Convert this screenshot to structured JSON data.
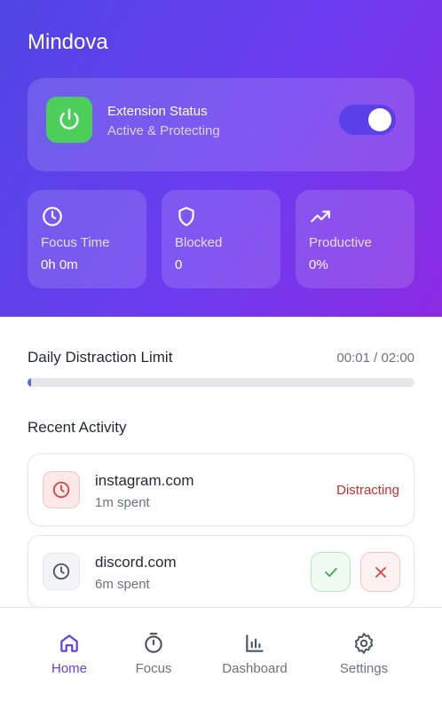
{
  "app": {
    "title": "Mindova"
  },
  "status": {
    "title": "Extension Status",
    "subtitle": "Active & Protecting",
    "enabled": true,
    "icon": "power-icon"
  },
  "stats": [
    {
      "icon": "clock-icon",
      "label": "Focus Time",
      "value": "0h 0m"
    },
    {
      "icon": "shield-icon",
      "label": "Blocked",
      "value": "0"
    },
    {
      "icon": "trending-up-icon",
      "label": "Productive",
      "value": "0%"
    }
  ],
  "limit": {
    "title": "Daily Distraction Limit",
    "time": "00:01 / 02:00",
    "progress_fraction": 0.008
  },
  "activity": {
    "title": "Recent Activity",
    "items": [
      {
        "site": "instagram.com",
        "time": "1m spent",
        "badge": "Distracting",
        "icon": "clock-icon"
      },
      {
        "site": "discord.com",
        "time": "6m spent",
        "icon": "clock-icon"
      }
    ]
  },
  "nav": [
    {
      "label": "Home",
      "icon": "home-icon",
      "active": true
    },
    {
      "label": "Focus",
      "icon": "timer-icon",
      "active": false
    },
    {
      "label": "Dashboard",
      "icon": "bar-chart-icon",
      "active": false
    },
    {
      "label": "Settings",
      "icon": "gear-icon",
      "active": false
    }
  ],
  "colors": {
    "gradient_start": "#4f46e5",
    "gradient_end": "#8b2be2",
    "power_green": "#4ccf5a",
    "accent": "#5b3fe8",
    "distracting_red": "#c53030"
  }
}
